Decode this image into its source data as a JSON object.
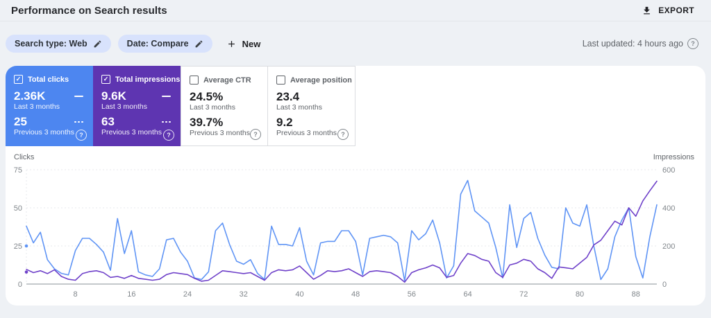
{
  "header": {
    "title": "Performance on Search results",
    "export_label": "EXPORT"
  },
  "filters": {
    "chips": [
      {
        "label": "Search type: Web"
      },
      {
        "label": "Date: Compare"
      }
    ],
    "new_label": "New",
    "last_updated": "Last updated: 4 hours ago"
  },
  "cards": [
    {
      "label": "Total clicks",
      "checked": true,
      "bg": "#4d86f0",
      "current": "2.36K",
      "current_period": "Last 3 months",
      "previous": "25",
      "previous_period": "Previous 3 months"
    },
    {
      "label": "Total impressions",
      "checked": true,
      "bg": "#5e35b1",
      "current": "9.6K",
      "current_period": "Last 3 months",
      "previous": "63",
      "previous_period": "Previous 3 months"
    },
    {
      "label": "Average CTR",
      "checked": false,
      "bg": "#ffffff",
      "current": "24.5%",
      "current_period": "Last 3 months",
      "previous": "39.7%",
      "previous_period": "Previous 3 months"
    },
    {
      "label": "Average position",
      "checked": false,
      "bg": "#ffffff",
      "current": "23.4",
      "current_period": "Last 3 months",
      "previous": "9.2",
      "previous_period": "Previous 3 months"
    }
  ],
  "chart_data": {
    "type": "line",
    "days": 91,
    "x_ticks": [
      8,
      16,
      24,
      32,
      40,
      48,
      56,
      64,
      72,
      80,
      88
    ],
    "left_axis": {
      "label": "Clicks",
      "ticks": [
        0,
        25,
        50,
        75
      ],
      "max": 75
    },
    "right_axis": {
      "label": "Impressions",
      "ticks": [
        0,
        200,
        400,
        600
      ],
      "max": 600
    },
    "grid": true,
    "series": [
      {
        "name": "Clicks - last 3 months",
        "axis": "left",
        "color": "#5f94f5",
        "values": [
          38,
          27,
          34,
          16,
          10,
          7,
          6,
          22,
          30,
          30,
          26,
          21,
          9,
          43,
          20,
          35,
          8,
          6,
          5,
          10,
          29,
          30,
          21,
          15,
          4,
          3,
          8,
          35,
          40,
          26,
          15,
          13,
          16,
          7,
          3,
          38,
          26,
          26,
          25,
          37,
          15,
          6,
          27,
          28,
          28,
          35,
          35,
          28,
          6,
          30,
          31,
          32,
          31,
          27,
          2,
          35,
          29,
          33,
          42,
          27,
          4,
          12,
          59,
          68,
          48,
          44,
          40,
          24,
          4,
          52,
          24,
          43,
          47,
          30,
          19,
          11,
          10,
          50,
          40,
          38,
          52,
          25,
          3,
          10,
          31,
          42,
          50,
          18,
          4,
          31,
          52
        ]
      },
      {
        "name": "Impressions - last 3 months",
        "axis": "right",
        "color": "#6e40c9",
        "values": [
          77,
          60,
          70,
          55,
          75,
          40,
          25,
          20,
          55,
          65,
          70,
          60,
          35,
          40,
          30,
          45,
          30,
          25,
          20,
          25,
          50,
          60,
          55,
          50,
          30,
          15,
          20,
          45,
          70,
          65,
          60,
          55,
          60,
          40,
          20,
          60,
          75,
          70,
          75,
          95,
          60,
          25,
          45,
          70,
          65,
          70,
          80,
          60,
          40,
          65,
          70,
          65,
          60,
          40,
          10,
          60,
          75,
          85,
          100,
          85,
          35,
          45,
          110,
          160,
          150,
          130,
          120,
          60,
          35,
          100,
          110,
          130,
          120,
          80,
          60,
          30,
          90,
          85,
          80,
          110,
          140,
          205,
          230,
          280,
          330,
          310,
          400,
          356,
          436,
          490,
          540
        ]
      }
    ],
    "previous_period_points": [
      {
        "name": "Clicks - previous 3 months",
        "axis": "left",
        "day": 1,
        "value": 25,
        "color": "#5f94f5"
      },
      {
        "name": "Impressions - previous 3 months",
        "axis": "right",
        "day": 1,
        "value": 63,
        "color": "#6e40c9"
      }
    ]
  },
  "colors": {
    "clicks_accent": "#4d86f0",
    "impressions_accent": "#5e35b1",
    "chip_bg": "#d8e2fc",
    "page_bg": "#eef1f5",
    "tick_text": "#80868b"
  }
}
